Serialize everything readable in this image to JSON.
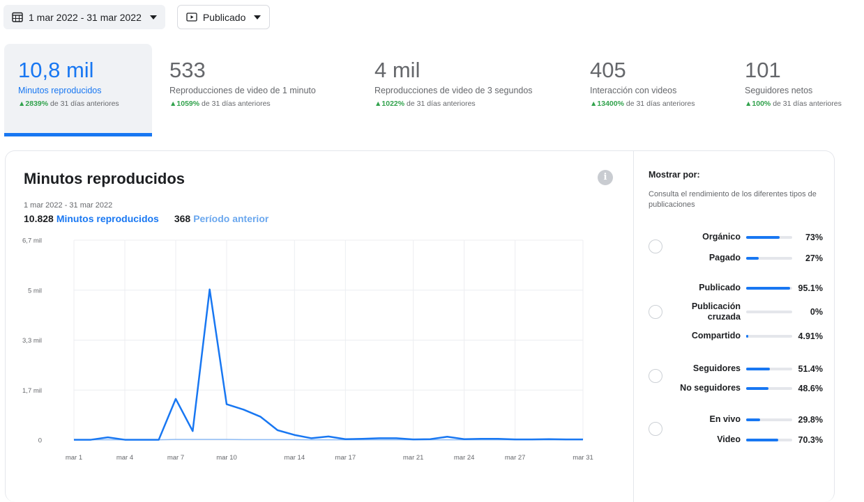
{
  "filters": {
    "date_range": "1 mar 2022 - 31 mar 2022",
    "post_type": "Publicado"
  },
  "metrics": [
    {
      "value": "10,8 mil",
      "label": "Minutos reproducidos",
      "change_pct": "2839%",
      "change_text": "de 31 días anteriores",
      "active": true
    },
    {
      "value": "533",
      "label": "Reproducciones de video de 1 minuto",
      "change_pct": "1059%",
      "change_text": "de 31 días anteriores",
      "active": false
    },
    {
      "value": "4 mil",
      "label": "Reproducciones de video de 3 segundos",
      "change_pct": "1022%",
      "change_text": "de 31 días anteriores",
      "active": false
    },
    {
      "value": "405",
      "label": "Interacción con videos",
      "change_pct": "13400%",
      "change_text": "de 31 días anteriores",
      "active": false
    },
    {
      "value": "101",
      "label": "Seguidores netos",
      "change_pct": "100%",
      "change_text": "de 31 días anteriores",
      "active": false
    }
  ],
  "chart_card": {
    "title": "Minutos reproducidos",
    "range": "1 mar 2022 - 31 mar 2022",
    "total": "10.828",
    "total_label": "Minutos reproducidos",
    "previous_total": "368",
    "previous_label": "Período anterior"
  },
  "chart_data": {
    "type": "line",
    "title": "Minutos reproducidos",
    "x_tick_labels": [
      "mar 1",
      "mar 4",
      "mar 7",
      "mar 10",
      "mar 14",
      "mar 17",
      "mar 21",
      "mar 24",
      "mar 27",
      "mar 31"
    ],
    "y_tick_labels": [
      "0",
      "1,7 mil",
      "3,3 mil",
      "5 mil",
      "6,7 mil"
    ],
    "ylim": [
      0,
      6700
    ],
    "grid": true,
    "x": [
      1,
      2,
      3,
      4,
      5,
      6,
      7,
      8,
      9,
      10,
      11,
      12,
      13,
      14,
      15,
      16,
      17,
      18,
      19,
      20,
      21,
      22,
      23,
      24,
      25,
      26,
      27,
      28,
      29,
      30,
      31
    ],
    "series": [
      {
        "name": "Minutos reproducidos",
        "color": "#1877f2",
        "values": [
          10,
          10,
          90,
          10,
          10,
          10,
          1380,
          300,
          5050,
          1200,
          1020,
          780,
          330,
          170,
          60,
          120,
          30,
          40,
          60,
          60,
          20,
          30,
          110,
          30,
          40,
          40,
          20,
          20,
          30,
          20,
          20
        ]
      },
      {
        "name": "Período anterior",
        "color": "#8fbcf5",
        "values": [
          10,
          10,
          10,
          10,
          10,
          10,
          20,
          20,
          20,
          20,
          15,
          15,
          15,
          15,
          10,
          10,
          10,
          10,
          10,
          10,
          10,
          10,
          10,
          10,
          10,
          10,
          10,
          10,
          10,
          10,
          10
        ]
      }
    ]
  },
  "panel": {
    "title": "Mostrar por:",
    "description": "Consulta el rendimiento de los diferentes tipos de publicaciones",
    "groups": [
      {
        "items": [
          {
            "label": "Orgánico",
            "pct": "73%",
            "value": 73
          },
          {
            "label": "Pagado",
            "pct": "27%",
            "value": 27
          }
        ]
      },
      {
        "items": [
          {
            "label": "Publicado",
            "pct": "95.1%",
            "value": 95.1
          },
          {
            "label": "Publicación cruzada",
            "pct": "0%",
            "value": 0
          },
          {
            "label": "Compartido",
            "pct": "4.91%",
            "value": 4.91
          }
        ]
      },
      {
        "items": [
          {
            "label": "Seguidores",
            "pct": "51.4%",
            "value": 51.4
          },
          {
            "label": "No seguidores",
            "pct": "48.6%",
            "value": 48.6
          }
        ]
      },
      {
        "items": [
          {
            "label": "En vivo",
            "pct": "29.8%",
            "value": 29.8
          },
          {
            "label": "Video",
            "pct": "70.3%",
            "value": 70.3
          }
        ]
      }
    ]
  },
  "colors": {
    "accent": "#1877f2",
    "positive": "#31a24c",
    "muted": "#65676b"
  }
}
